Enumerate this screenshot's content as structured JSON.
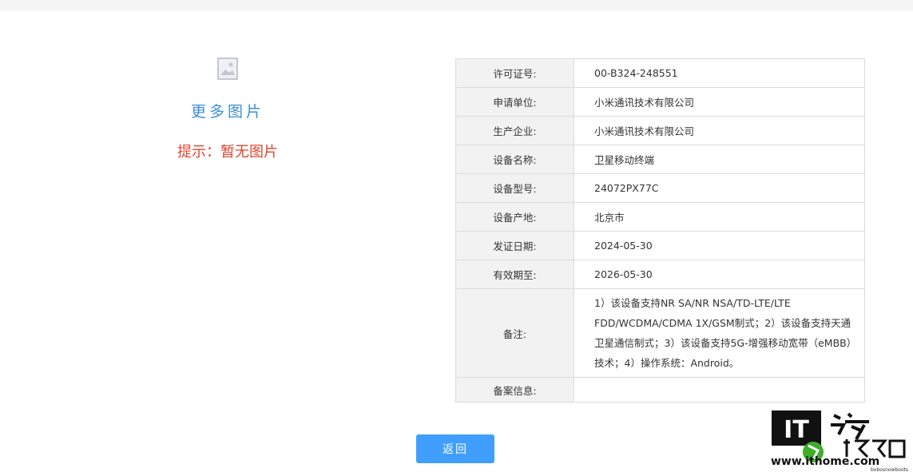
{
  "left": {
    "more_images": "更多图片",
    "hint": "提示：暂无图片"
  },
  "table": {
    "rows": [
      {
        "label": "许可证号:",
        "value": "00-B324-248551"
      },
      {
        "label": "申请单位:",
        "value": "小米通讯技术有限公司"
      },
      {
        "label": "生产企业:",
        "value": "小米通讯技术有限公司"
      },
      {
        "label": "设备名称:",
        "value": "卫星移动终端"
      },
      {
        "label": "设备型号:",
        "value": "24072PX77C"
      },
      {
        "label": "设备产地:",
        "value": "北京市"
      },
      {
        "label": "发证日期:",
        "value": "2024-05-30"
      },
      {
        "label": "有效期至:",
        "value": "2026-05-30"
      },
      {
        "label": "备注:",
        "value": "1）该设备支持NR SA/NR NSA/TD-LTE/LTE FDD/WCDMA/CDMA 1X/GSM制式；2）该设备支持天通卫星通信制式；3）该设备支持5G-增强移动宽带（eMBB）技术；4）操作系统：Android。"
      },
      {
        "label": "备案信息:",
        "value": ""
      }
    ]
  },
  "back_button": "返回",
  "watermark": {
    "logo_text": "IT",
    "site_text": "www.ithome.com",
    "small_text": "bobosnowboots"
  },
  "colors": {
    "link": "#3a8fd8",
    "hint": "#e0452e",
    "button": "#409eff",
    "label_bg": "#f2f2f2"
  }
}
